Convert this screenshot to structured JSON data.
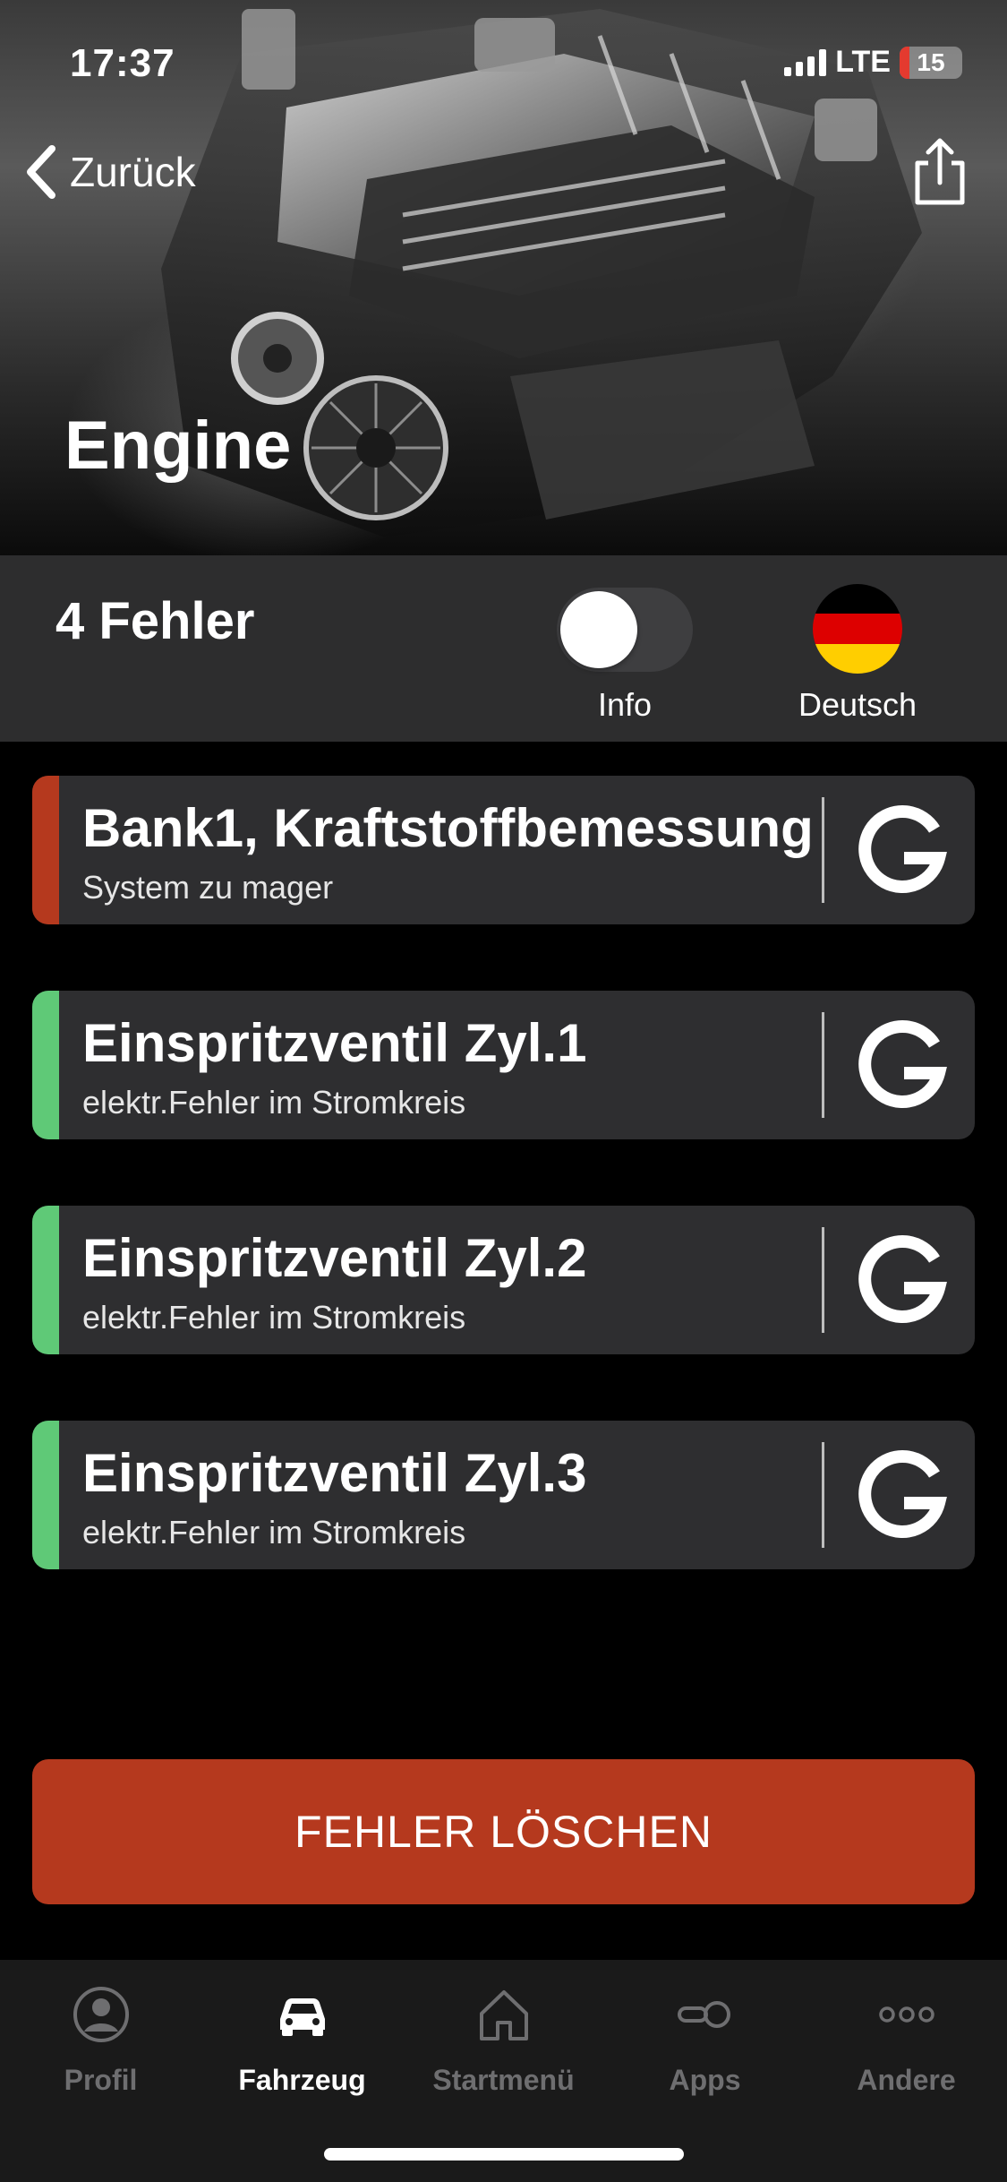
{
  "status": {
    "time": "17:37",
    "network": "LTE",
    "battery": "15",
    "battery_level": 0.15
  },
  "nav": {
    "back_label": "Zurück",
    "share_icon": "share-icon"
  },
  "page": {
    "title": "Engine"
  },
  "summary": {
    "fault_count": "4 Fehler",
    "info_label": "Info",
    "info_enabled": false,
    "language_label": "Deutsch",
    "flag_colors": [
      "#000000",
      "#dd0000",
      "#ffce00"
    ]
  },
  "faults": [
    {
      "title": "Bank1, Kraftstoffbemessung",
      "subtitle": "System zu mager",
      "status_color": "#b5391e"
    },
    {
      "title": "Einspritzventil Zyl.1",
      "subtitle": "elektr.Fehler im Stromkreis",
      "status_color": "#5fc977"
    },
    {
      "title": "Einspritzventil Zyl.2",
      "subtitle": "elektr.Fehler im Stromkreis",
      "status_color": "#5fc977"
    },
    {
      "title": "Einspritzventil Zyl.3",
      "subtitle": "elektr.Fehler im Stromkreis",
      "status_color": "#5fc977"
    }
  ],
  "actions": {
    "clear_label": "FEHLER LÖSCHEN",
    "clear_color": "#b5391e"
  },
  "tabbar": {
    "items": [
      {
        "label": "Profil",
        "icon": "profile-icon",
        "active": false
      },
      {
        "label": "Fahrzeug",
        "icon": "car-icon",
        "active": true
      },
      {
        "label": "Startmenü",
        "icon": "home-icon",
        "active": false
      },
      {
        "label": "Apps",
        "icon": "apps-icon",
        "active": false
      },
      {
        "label": "Andere",
        "icon": "more-icon",
        "active": false
      }
    ]
  }
}
